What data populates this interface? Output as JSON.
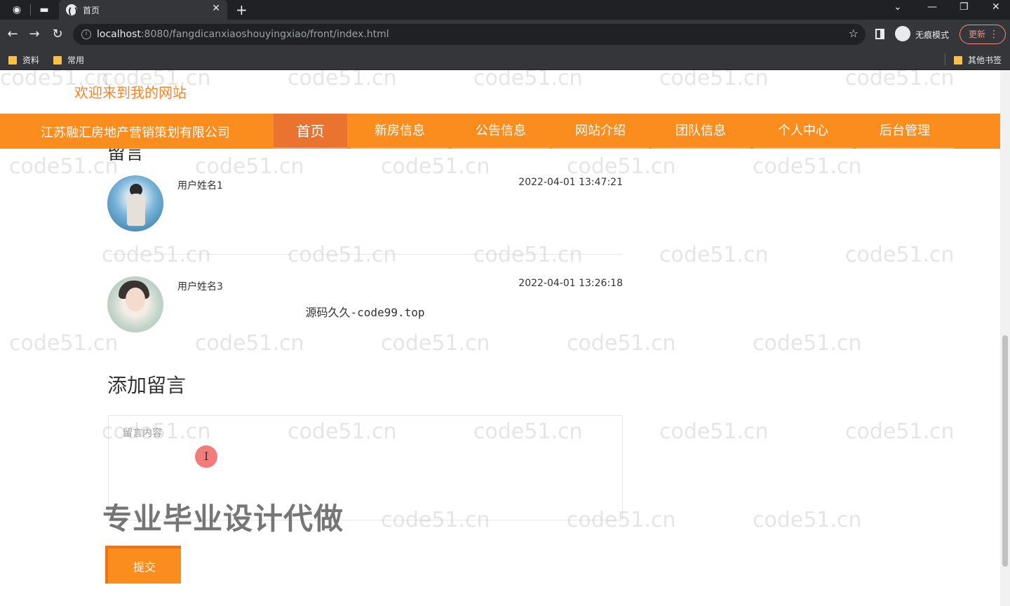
{
  "browser": {
    "tab_title": "首页",
    "url_host": "localhost",
    "url_path": ":8080/fangdicanxiaoshouyingxiao/front/index.html",
    "incognito_label": "无痕模式",
    "update_label": "更新",
    "bookmarks": [
      "资料",
      "常用"
    ],
    "other_bookmarks": "其他书签"
  },
  "site": {
    "welcome": "欢迎来到我的网站",
    "brand": "江苏融汇房地产营销策划有限公司",
    "nav": [
      "首页",
      "新房信息",
      "公告信息",
      "网站介绍",
      "团队信息",
      "个人中心",
      "后台管理"
    ],
    "active_nav": "首页"
  },
  "section_title_partial": "留言",
  "comments": [
    {
      "user": "用户姓名1",
      "time": "2022-04-01 13:47:21",
      "content": ""
    },
    {
      "user": "用户姓名3",
      "time": "2022-04-01 13:26:18",
      "content": "源码久久-code99.top"
    }
  ],
  "form": {
    "title": "添加留言",
    "placeholder": "留言内容",
    "submit_label": "提交"
  },
  "overlay_promo": "专业毕业设计代做",
  "watermark_text": "code51.cn",
  "colors": {
    "accent": "#fb8c1e",
    "active_nav": "#ea7330",
    "welcome": "#f2852a"
  }
}
